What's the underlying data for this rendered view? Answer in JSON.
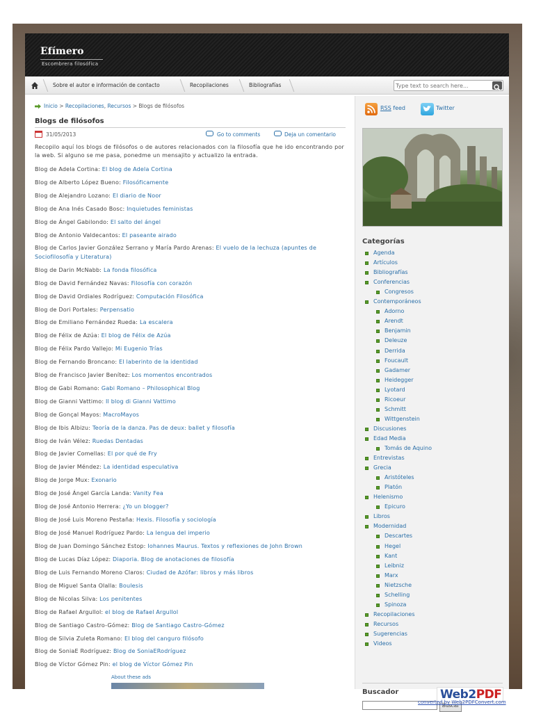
{
  "header": {
    "site_title": "Efímero",
    "tagline": "Escombrera filosófica"
  },
  "nav": {
    "items": [
      "Sobre el autor e información de contacto",
      "Recopilaciones",
      "Bibliografías"
    ],
    "search_placeholder": "Type text to search here..."
  },
  "breadcrumb": {
    "home": "Inicio",
    "sep1": " > ",
    "cat1": "Recopilaciones",
    "comma": ", ",
    "cat2": "Recursos",
    "sep2": " > ",
    "current": "Blogs de filósofos"
  },
  "post": {
    "title": "Blogs de filósofos",
    "date": "31/05/2013",
    "comments_link": "Go to comments",
    "leave_comment": "Deja un comentario",
    "intro": "Recopilo aquí los blogs de filósofos o de autores relacionados con la filosofía que he ido encontrando por la web. Si alguno se me pasa, ponedme un mensajito y actualizo la entrada.",
    "blogs": [
      {
        "author": "Blog de Adela Cortina: ",
        "link": "El blog de Adela Cortina"
      },
      {
        "author": "Blog de Alberto López Bueno: ",
        "link": "Filosóficamente"
      },
      {
        "author": "Blog de Alejandro Lozano: ",
        "link": "El diario de Noor"
      },
      {
        "author": "Blog de Ana Inés Casado Bosc: ",
        "link": "Inquietudes feministas"
      },
      {
        "author": "Blog de Ángel Gabilondo: ",
        "link": "El salto del ángel"
      },
      {
        "author": "Blog de Antonio Valdecantos: ",
        "link": "El paseante airado"
      },
      {
        "author": "Blog de Carlos Javier González Serrano y María Pardo Arenas: ",
        "link": "El vuelo de la lechuza (apuntes de Sociofilosofía y Literatura)"
      },
      {
        "author": "Blog de Darin McNabb: ",
        "link": "La fonda filosófica"
      },
      {
        "author": "Blog de David Fernández Navas: ",
        "link": "Filosofía con corazón"
      },
      {
        "author": "Blog de David Ordiales Rodríguez: ",
        "link": "Computación Filosófica"
      },
      {
        "author": "Blog de Dori Portales: ",
        "link": "Perpensatio"
      },
      {
        "author": "Blog de Emiliano Fernández Rueda: ",
        "link": "La escalera"
      },
      {
        "author": "Blog de Félix de Azúa: ",
        "link": "El blog de Félix de Azúa"
      },
      {
        "author": "Blog de Félix Pardo Vallejo: ",
        "link": "Mi Eugenio Trías"
      },
      {
        "author": "Blog de Fernando Broncano: ",
        "link": "El laberinto de la identidad"
      },
      {
        "author": "Blog de Francisco Javier Benítez: ",
        "link": "Los momentos encontrados"
      },
      {
        "author": "Blog de Gabi Romano: ",
        "link": "Gabi Romano – Philosophical Blog"
      },
      {
        "author": "Blog de Gianni Vattimo: ",
        "link": "Il blog di Gianni Vattimo"
      },
      {
        "author": "Blog de Gonçal Mayos: ",
        "link": "MacroMayos"
      },
      {
        "author": "Blog de Ibis Albizu: ",
        "link": "Teoría de la danza. Pas de deux: ballet y filosofía"
      },
      {
        "author": "Blog de Iván Vélez: ",
        "link": "Ruedas Dentadas"
      },
      {
        "author": "Blog de Javier Comellas: ",
        "link": "El por qué de Fry"
      },
      {
        "author": "Blog de Javier Méndez: ",
        "link": "La identidad especulativa"
      },
      {
        "author": "Blog de Jorge Mux: ",
        "link": "Exonario"
      },
      {
        "author": "Blog de José Ángel García Landa: ",
        "link": "Vanity Fea"
      },
      {
        "author": "Blog de José Antonio Herrera: ",
        "link": "¿Yo un blogger?"
      },
      {
        "author": "Blog de José Luis Moreno Pestaña: ",
        "link": "Hexis. Filosofía y sociología"
      },
      {
        "author": "Blog de José Manuel Rodríguez Pardo: ",
        "link": "La lengua del imperio"
      },
      {
        "author": "Blog de Juan Domingo Sánchez Estop: ",
        "link": "Iohannes Maurus. Textos y reflexiones de John Brown"
      },
      {
        "author": "Blog de Lucas Díaz López: ",
        "link": "Diaporia. Blog de anotaciones de filosofía"
      },
      {
        "author": "Blog de Luis Fernando Moreno Claros: ",
        "link": "Ciudad de Azófar: libros y más libros"
      },
      {
        "author": "Blog de Miguel Santa Olalla: ",
        "link": "Boulesis"
      },
      {
        "author": "Blog de Nicolas Silva: ",
        "link": "Los penitentes"
      },
      {
        "author": "Blog de Rafael Argullol: ",
        "link": "el blog de Rafael Argullol"
      },
      {
        "author": "Blog de Santiago Castro-Gómez: ",
        "link": "Blog de Santiago Castro-Gómez"
      },
      {
        "author": "Blog de Silvia Zuleta Romano: ",
        "link": "El blog del canguro filósofo"
      },
      {
        "author": "Blog de SoniaE Rodríguez: ",
        "link": "Blog de SoniaERodríguez"
      },
      {
        "author": "Blog de Víctor Gómez Pin: ",
        "link": "el blog de Víctor Gómez Pin"
      }
    ],
    "ads_label": "About these ads"
  },
  "sidebar": {
    "rss": "RSS",
    "feed": " feed",
    "twitter": "Twitter",
    "categories_title": "Categorías",
    "categories": [
      {
        "label": "Agenda",
        "level": 0
      },
      {
        "label": "Artículos",
        "level": 0
      },
      {
        "label": "Bibliografías",
        "level": 0
      },
      {
        "label": "Conferencias",
        "level": 0
      },
      {
        "label": "Congresos",
        "level": 1
      },
      {
        "label": "Contemporáneos",
        "level": 0
      },
      {
        "label": "Adorno",
        "level": 1
      },
      {
        "label": "Arendt",
        "level": 1
      },
      {
        "label": "Benjamin",
        "level": 1
      },
      {
        "label": "Deleuze",
        "level": 1
      },
      {
        "label": "Derrida",
        "level": 1
      },
      {
        "label": "Foucault",
        "level": 1
      },
      {
        "label": "Gadamer",
        "level": 1
      },
      {
        "label": "Heidegger",
        "level": 1
      },
      {
        "label": "Lyotard",
        "level": 1
      },
      {
        "label": "Ricoeur",
        "level": 1
      },
      {
        "label": "Schmitt",
        "level": 1
      },
      {
        "label": "Wittgenstein",
        "level": 1
      },
      {
        "label": "Discusiones",
        "level": 0
      },
      {
        "label": "Edad Media",
        "level": 0
      },
      {
        "label": "Tomás de Aquino",
        "level": 1
      },
      {
        "label": "Entrevistas",
        "level": 0
      },
      {
        "label": "Grecia",
        "level": 0
      },
      {
        "label": "Aristóteles",
        "level": 1
      },
      {
        "label": "Platón",
        "level": 1
      },
      {
        "label": "Helenismo",
        "level": 0
      },
      {
        "label": "Epicuro",
        "level": 1
      },
      {
        "label": "Libros",
        "level": 0
      },
      {
        "label": "Modernidad",
        "level": 0
      },
      {
        "label": "Descartes",
        "level": 1
      },
      {
        "label": "Hegel",
        "level": 1
      },
      {
        "label": "Kant",
        "level": 1
      },
      {
        "label": "Leibniz",
        "level": 1
      },
      {
        "label": "Marx",
        "level": 1
      },
      {
        "label": "Nietzsche",
        "level": 1
      },
      {
        "label": "Schelling",
        "level": 1
      },
      {
        "label": "Spinoza",
        "level": 1
      },
      {
        "label": "Recopilaciones",
        "level": 0
      },
      {
        "label": "Recursos",
        "level": 0
      },
      {
        "label": "Sugerencias",
        "level": 0
      },
      {
        "label": "Videos",
        "level": 0
      }
    ],
    "buscador_title": "Buscador",
    "buscador_button": "Buscar"
  },
  "watermark": {
    "logo_a": "Web2",
    "logo_b": "PDF",
    "converted": "converted by Web2PDFConvert.com"
  },
  "colors": {
    "link": "#2a6fa8",
    "bullet": "#5a9a2a",
    "header_bg": "#1c1c1c",
    "sidebar_bg": "#f2f2f2"
  }
}
